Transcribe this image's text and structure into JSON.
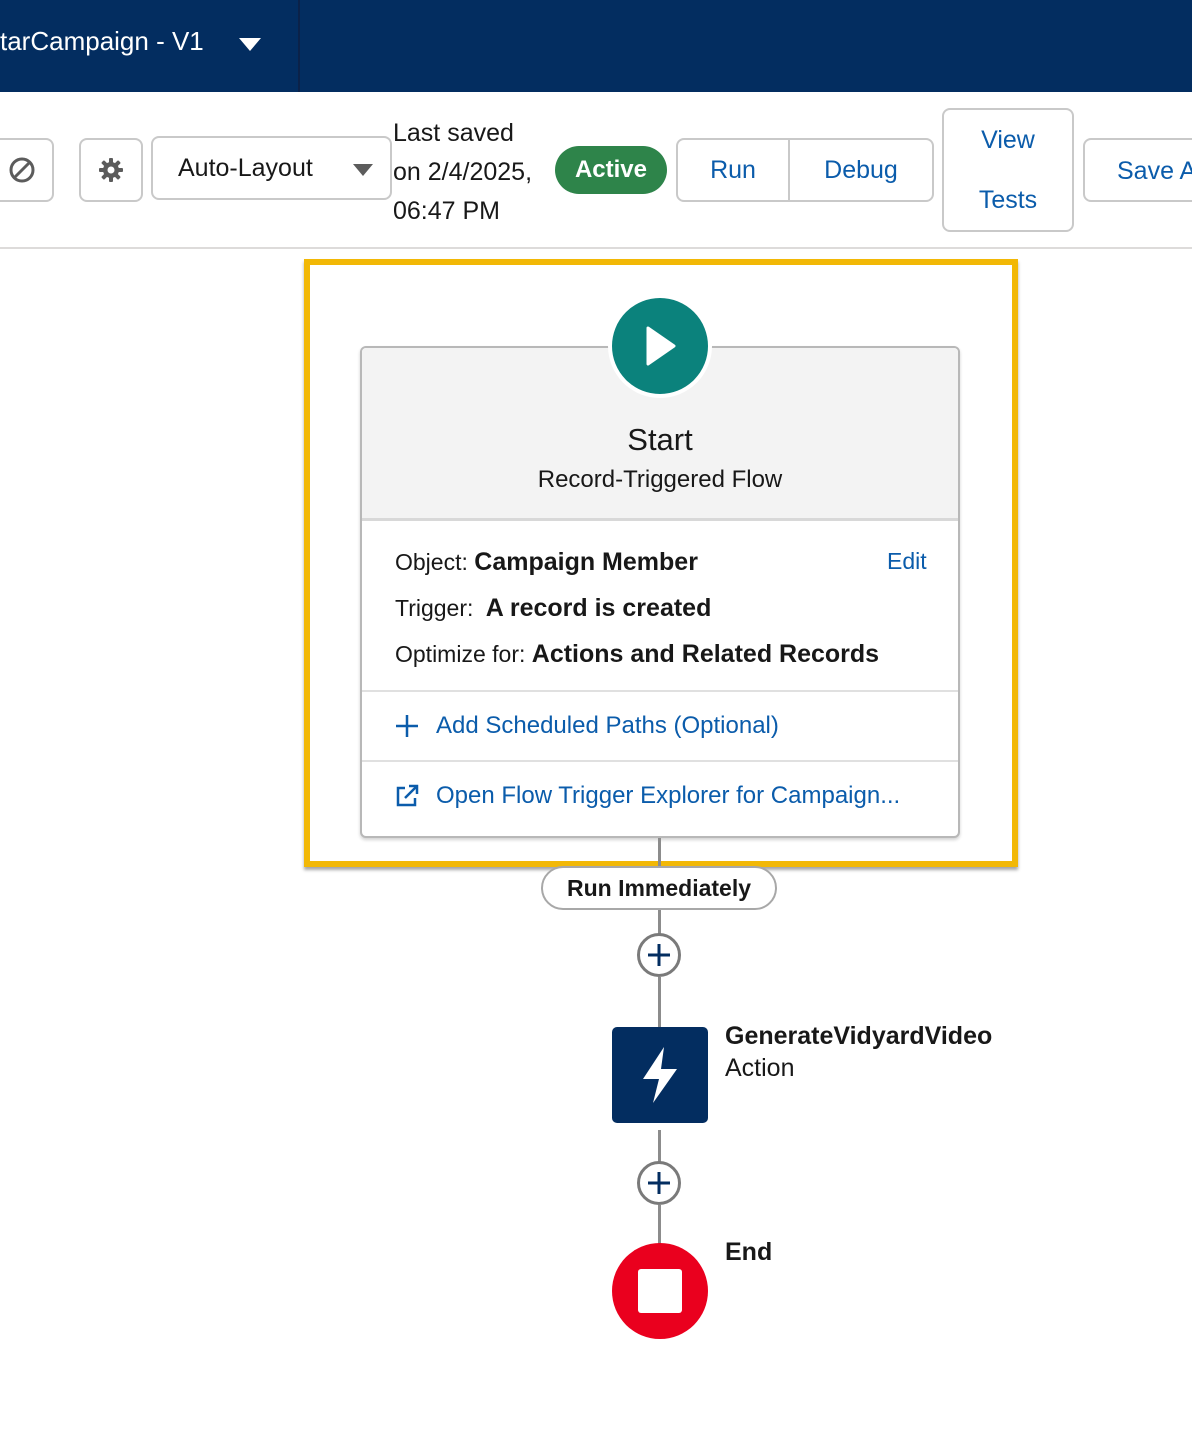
{
  "header": {
    "flow_title": "tarCampaign - V1"
  },
  "toolbar": {
    "layout_select": "Auto-Layout",
    "last_saved_line1": "Last saved",
    "last_saved_line2": "on 2/4/2025,",
    "last_saved_line3": "06:47 PM",
    "status_badge": "Active",
    "run_label": "Run",
    "debug_label": "Debug",
    "view_tests_line1": "View",
    "view_tests_line2": "Tests",
    "save_label": "Save A"
  },
  "start_node": {
    "title": "Start",
    "subtitle": "Record-Triggered Flow",
    "object_label": "Object:",
    "object_value": "Campaign Member",
    "edit_label": "Edit",
    "trigger_label": "Trigger:",
    "trigger_value": "A record is created",
    "optimize_label": "Optimize for:",
    "optimize_value": "Actions and Related Records",
    "add_paths_label": "Add Scheduled Paths (Optional)",
    "open_explorer_label": "Open Flow Trigger Explorer for Campaign..."
  },
  "path": {
    "run_immediately": "Run Immediately"
  },
  "action_node": {
    "title": "GenerateVidyardVideo",
    "type": "Action"
  },
  "end_node": {
    "title": "End"
  },
  "icons": [
    "chevron-down-icon",
    "ban-icon",
    "gear-icon",
    "play-icon",
    "plus-icon",
    "external-link-icon",
    "lightning-icon",
    "stop-icon"
  ],
  "colors": {
    "header_bg": "#032d60",
    "link_blue": "#0b5cab",
    "active_green": "#2e844a",
    "start_teal": "#0b827c",
    "highlight_yellow": "#f2b806",
    "end_red": "#ea001e"
  }
}
